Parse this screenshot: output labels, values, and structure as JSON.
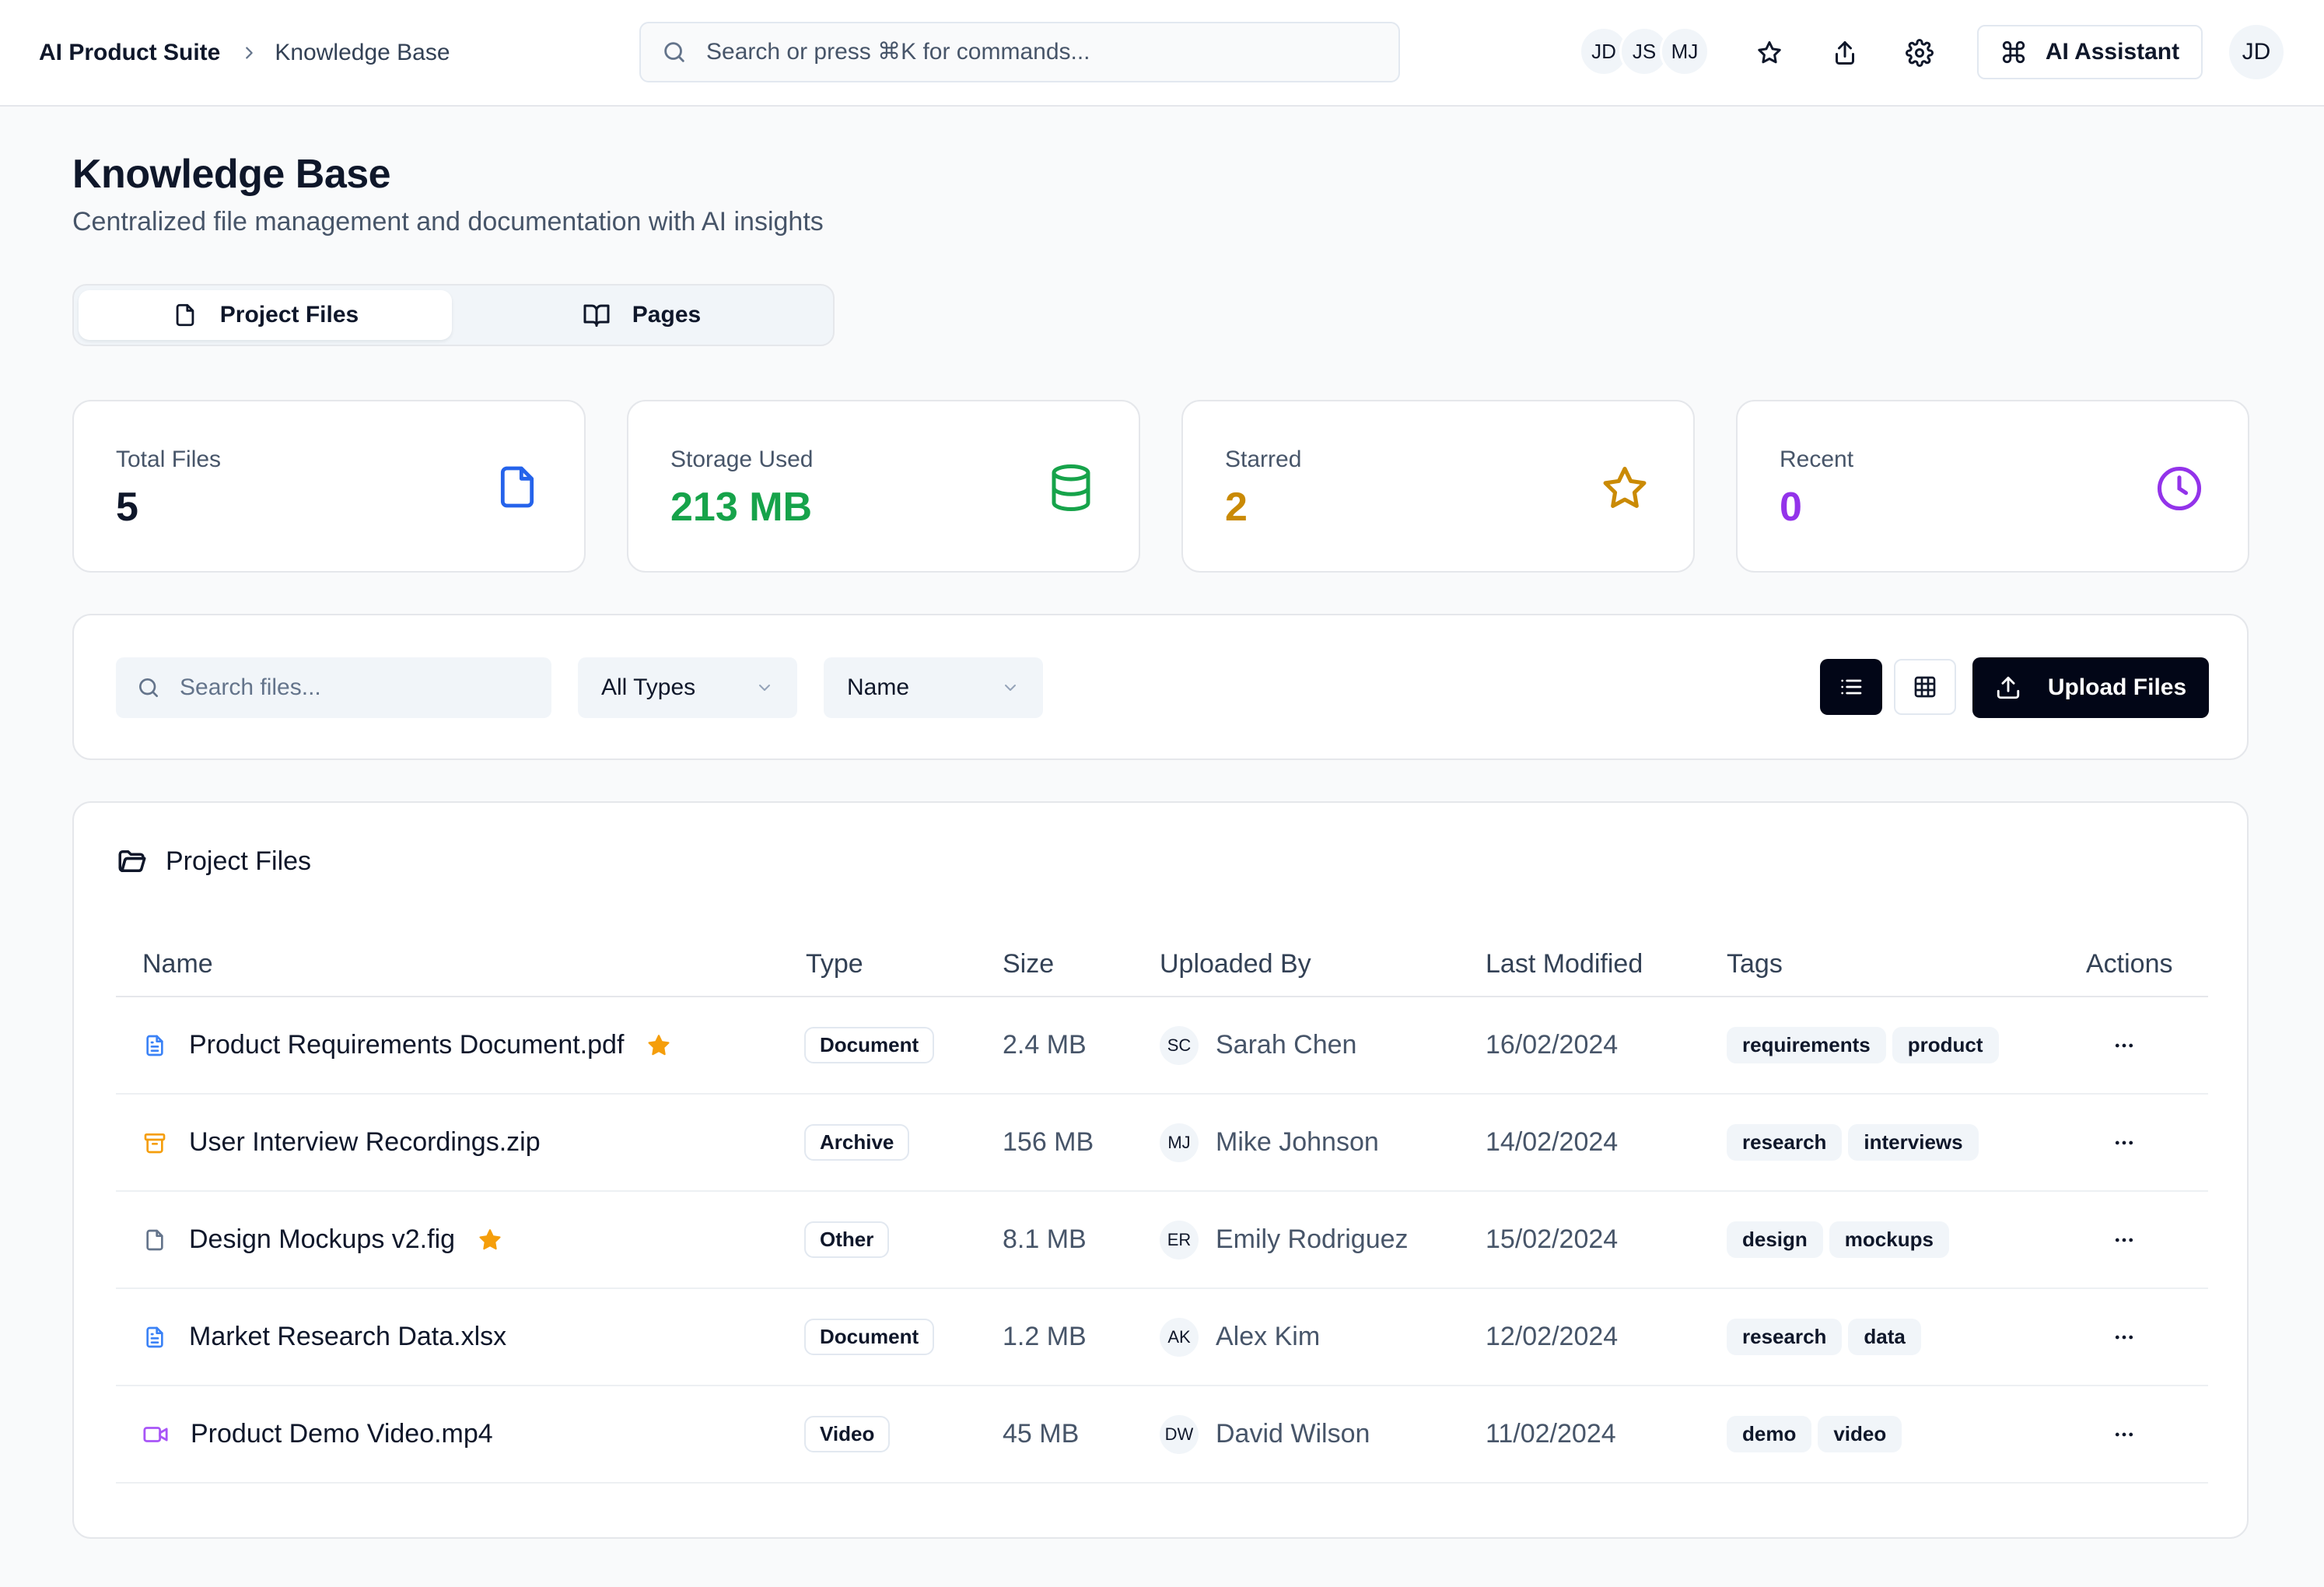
{
  "header": {
    "breadcrumb_root": "AI Product Suite",
    "breadcrumb_current": "Knowledge Base",
    "search_placeholder": "Search or press ⌘K for commands...",
    "collaborators": [
      "JD",
      "JS",
      "MJ"
    ],
    "ai_assistant_label": "AI Assistant",
    "user_initials": "JD"
  },
  "page": {
    "title": "Knowledge Base",
    "subtitle": "Centralized file management and documentation with AI insights"
  },
  "tabs": [
    {
      "label": "Project Files",
      "icon": "file-icon",
      "active": true
    },
    {
      "label": "Pages",
      "icon": "book-open-icon",
      "active": false
    }
  ],
  "stats": [
    {
      "label": "Total Files",
      "value": "5",
      "color": "#0f172a",
      "icon": "file-icon",
      "icon_color": "#2563eb"
    },
    {
      "label": "Storage Used",
      "value": "213 MB",
      "color": "#16a34a",
      "icon": "database-icon",
      "icon_color": "#16a34a"
    },
    {
      "label": "Starred",
      "value": "2",
      "color": "#ca8a04",
      "icon": "star-icon",
      "icon_color": "#ca8a04"
    },
    {
      "label": "Recent",
      "value": "0",
      "color": "#9333ea",
      "icon": "clock-icon",
      "icon_color": "#9333ea"
    }
  ],
  "toolbar": {
    "search_placeholder": "Search files...",
    "type_filter": "All Types",
    "sort_by": "Name",
    "view_mode": "list",
    "upload_label": "Upload Files"
  },
  "files_panel": {
    "title": "Project Files",
    "columns": [
      "Name",
      "Type",
      "Size",
      "Uploaded By",
      "Last Modified",
      "Tags",
      "Actions"
    ],
    "rows": [
      {
        "name": "Product Requirements Document.pdf",
        "icon": "document-icon",
        "icon_color": "#3b82f6",
        "starred": true,
        "type": "Document",
        "size": "2.4 MB",
        "uploader_initials": "SC",
        "uploader": "Sarah Chen",
        "modified": "16/02/2024",
        "tags": [
          "requirements",
          "product"
        ]
      },
      {
        "name": "User Interview Recordings.zip",
        "icon": "archive-icon",
        "icon_color": "#f59e0b",
        "starred": false,
        "type": "Archive",
        "size": "156 MB",
        "uploader_initials": "MJ",
        "uploader": "Mike Johnson",
        "modified": "14/02/2024",
        "tags": [
          "research",
          "interviews"
        ]
      },
      {
        "name": "Design Mockups v2.fig",
        "icon": "file-icon",
        "icon_color": "#64748b",
        "starred": true,
        "type": "Other",
        "size": "8.1 MB",
        "uploader_initials": "ER",
        "uploader": "Emily Rodriguez",
        "modified": "15/02/2024",
        "tags": [
          "design",
          "mockups"
        ]
      },
      {
        "name": "Market Research Data.xlsx",
        "icon": "document-icon",
        "icon_color": "#3b82f6",
        "starred": false,
        "type": "Document",
        "size": "1.2 MB",
        "uploader_initials": "AK",
        "uploader": "Alex Kim",
        "modified": "12/02/2024",
        "tags": [
          "research",
          "data"
        ]
      },
      {
        "name": "Product Demo Video.mp4",
        "icon": "video-icon",
        "icon_color": "#a855f7",
        "starred": false,
        "type": "Video",
        "size": "45 MB",
        "uploader_initials": "DW",
        "uploader": "David Wilson",
        "modified": "11/02/2024",
        "tags": [
          "demo",
          "video"
        ]
      }
    ]
  },
  "colors": {
    "star": "#f59e0b",
    "primary_dark": "#020617"
  }
}
